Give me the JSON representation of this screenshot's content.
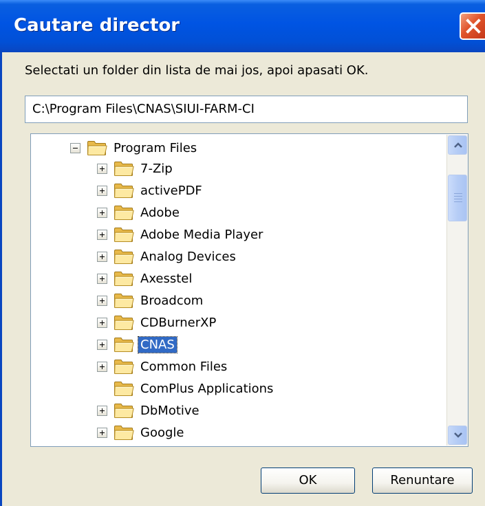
{
  "window": {
    "title": "Cautare director"
  },
  "instruction": "Selectati un folder din lista de mai jos, apoi apasati OK.",
  "path_field": {
    "value": "C:\\Program Files\\CNAS\\SIUI-FARM-CI"
  },
  "tree": {
    "parent": {
      "label": "Program Files",
      "expanded": true
    },
    "items": [
      {
        "label": "7-Zip",
        "has_children": true
      },
      {
        "label": "activePDF",
        "has_children": true
      },
      {
        "label": "Adobe",
        "has_children": true
      },
      {
        "label": "Adobe Media Player",
        "has_children": true
      },
      {
        "label": "Analog Devices",
        "has_children": true
      },
      {
        "label": "Axesstel",
        "has_children": true
      },
      {
        "label": "Broadcom",
        "has_children": true
      },
      {
        "label": "CDBurnerXP",
        "has_children": true
      },
      {
        "label": "CNAS",
        "has_children": true,
        "selected": true
      },
      {
        "label": "Common Files",
        "has_children": true
      },
      {
        "label": "ComPlus Applications",
        "has_children": false
      },
      {
        "label": "DbMotive",
        "has_children": true
      },
      {
        "label": "Google",
        "has_children": true
      }
    ]
  },
  "buttons": {
    "ok": "OK",
    "cancel": "Renuntare"
  },
  "colors": {
    "titlebar": "#0054e3",
    "selection": "#316ac5",
    "dialog_bg": "#ece9d8",
    "close_button": "#e0542a"
  }
}
